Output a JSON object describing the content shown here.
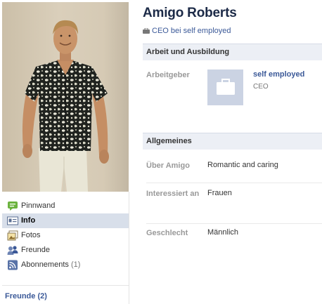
{
  "profile": {
    "name": "Amigo Roberts",
    "subtitle": "CEO bei self employed"
  },
  "nav": {
    "items": [
      {
        "label": "Pinnwand",
        "icon": "wall-speech-icon"
      },
      {
        "label": "Info",
        "icon": "info-card-icon",
        "active": true
      },
      {
        "label": "Fotos",
        "icon": "photos-icon"
      },
      {
        "label": "Freunde",
        "icon": "friends-icon"
      },
      {
        "label": "Abonnements",
        "icon": "rss-feed-icon",
        "count": "(1)"
      }
    ],
    "friends_link": "Freunde (2)"
  },
  "work": {
    "heading": "Arbeit und Ausbildung",
    "employer_label": "Arbeitgeber",
    "employer_name": "self employed",
    "employer_position": "CEO"
  },
  "general": {
    "heading": "Allgemeines",
    "rows": [
      {
        "label": "Über Amigo",
        "value": "Romantic and caring"
      },
      {
        "label": "Interessiert an",
        "value": "Frauen"
      },
      {
        "label": "Geschlecht",
        "value": "Männlich"
      }
    ]
  },
  "colors": {
    "link": "#3b5998",
    "name": "#1c2a47",
    "active_bg": "#d8dfea",
    "section_bg": "#eceff5"
  }
}
